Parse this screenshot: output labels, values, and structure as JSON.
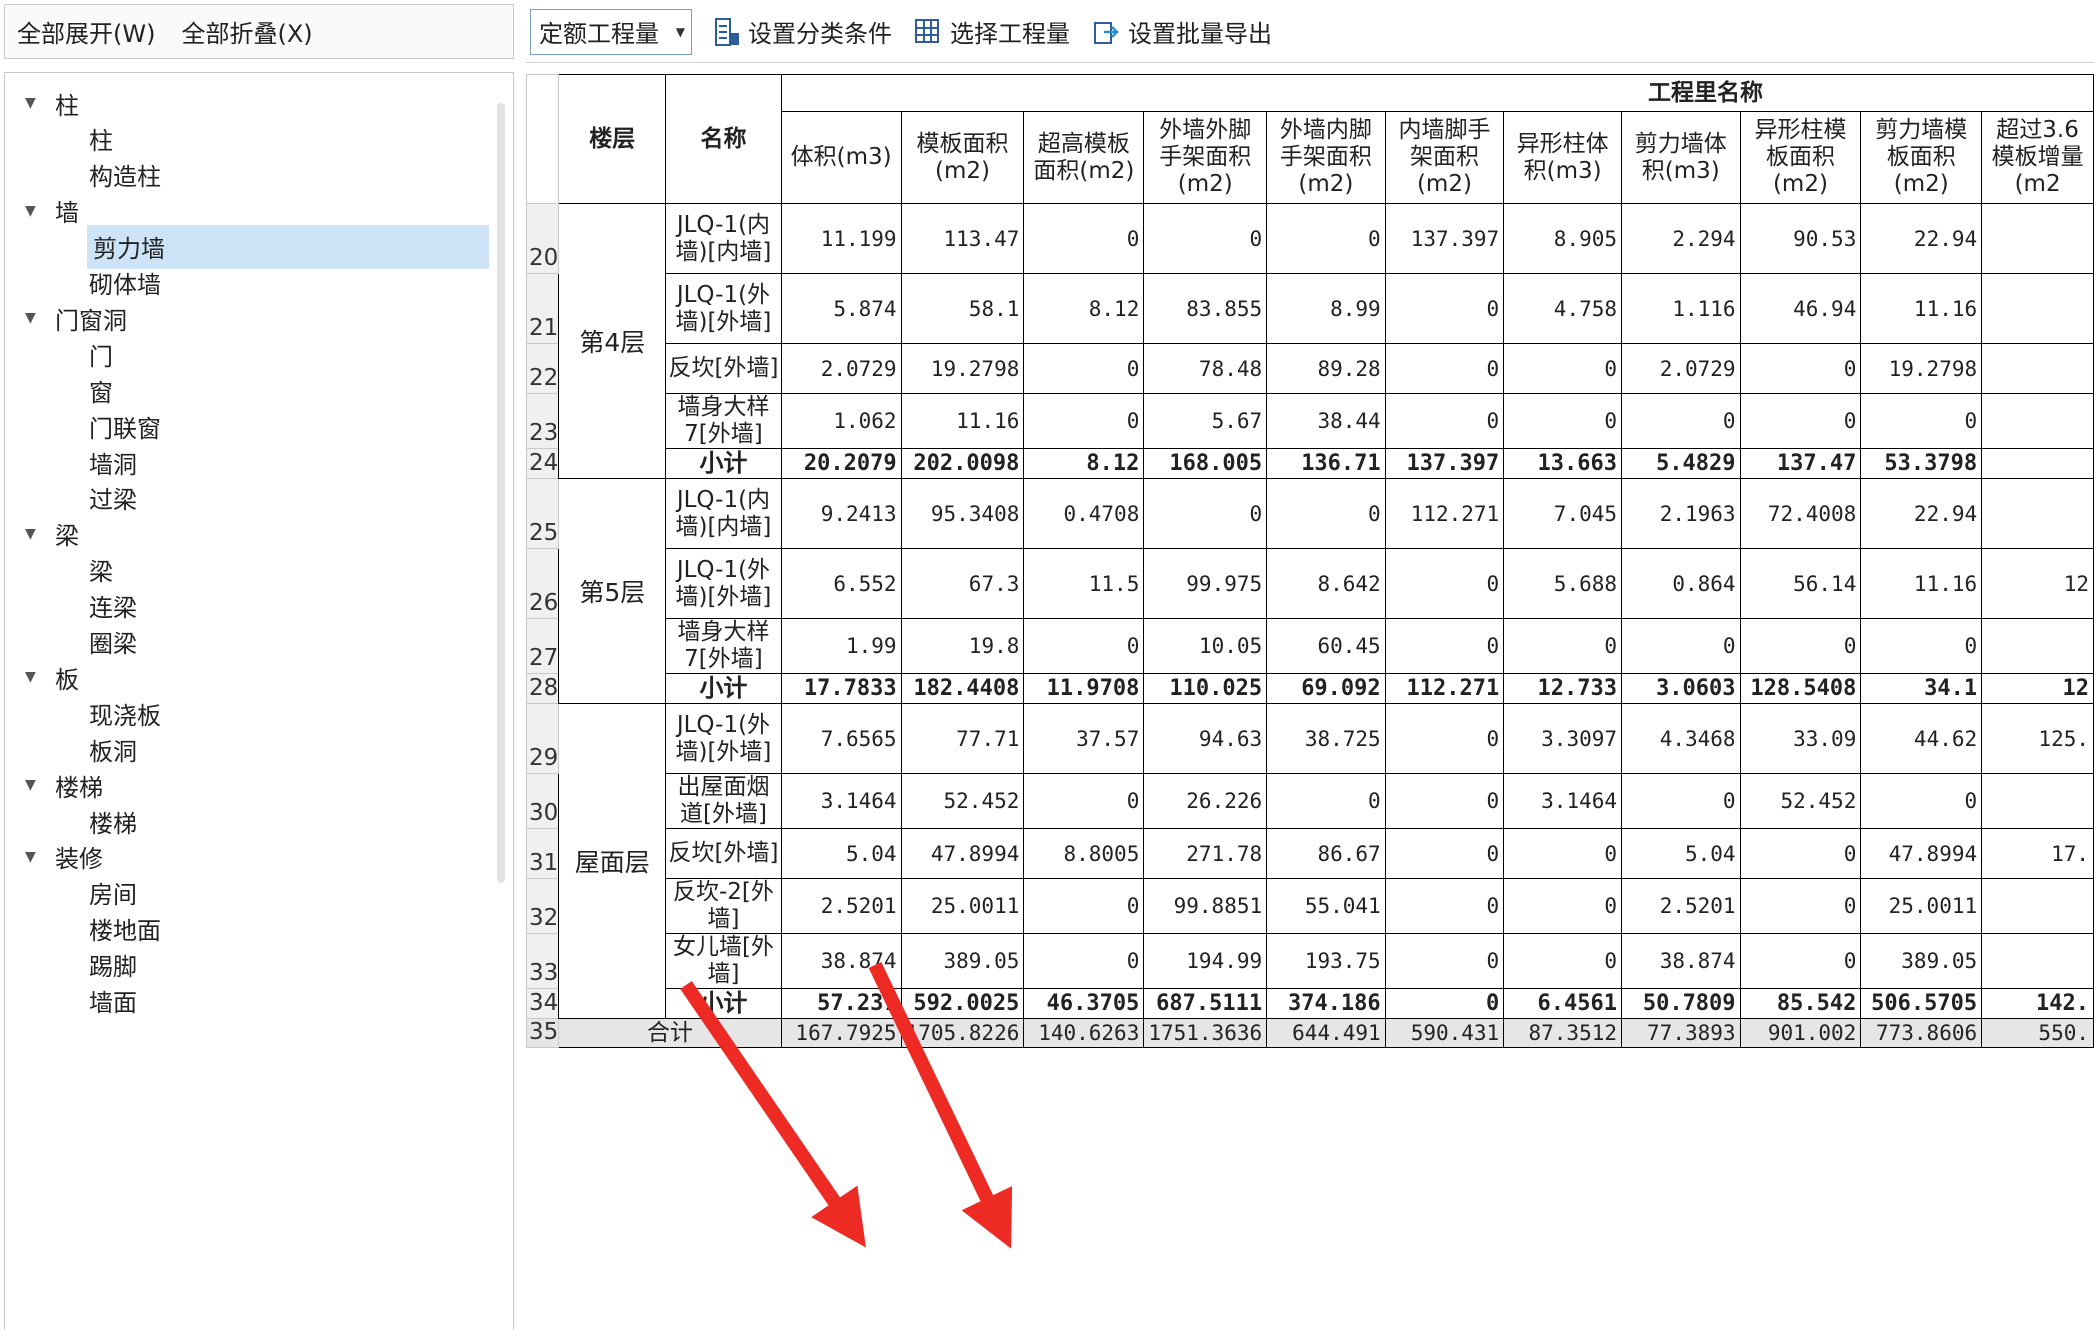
{
  "left_toolbar": {
    "expand_all": "全部展开(W)",
    "collapse_all": "全部折叠(X)"
  },
  "tree": [
    {
      "label": "柱",
      "type": "group"
    },
    {
      "label": "柱",
      "type": "child"
    },
    {
      "label": "构造柱",
      "type": "child"
    },
    {
      "label": "墙",
      "type": "group"
    },
    {
      "label": "剪力墙",
      "type": "child",
      "selected": true
    },
    {
      "label": "砌体墙",
      "type": "child"
    },
    {
      "label": "门窗洞",
      "type": "group"
    },
    {
      "label": "门",
      "type": "child"
    },
    {
      "label": "窗",
      "type": "child"
    },
    {
      "label": "门联窗",
      "type": "child"
    },
    {
      "label": "墙洞",
      "type": "child"
    },
    {
      "label": "过梁",
      "type": "child"
    },
    {
      "label": "梁",
      "type": "group"
    },
    {
      "label": "梁",
      "type": "child"
    },
    {
      "label": "连梁",
      "type": "child"
    },
    {
      "label": "圈梁",
      "type": "child"
    },
    {
      "label": "板",
      "type": "group"
    },
    {
      "label": "现浇板",
      "type": "child"
    },
    {
      "label": "板洞",
      "type": "child"
    },
    {
      "label": "楼梯",
      "type": "group"
    },
    {
      "label": "楼梯",
      "type": "child"
    },
    {
      "label": "装修",
      "type": "group"
    },
    {
      "label": "房间",
      "type": "child"
    },
    {
      "label": "楼地面",
      "type": "child"
    },
    {
      "label": "踢脚",
      "type": "child"
    },
    {
      "label": "墙面",
      "type": "child"
    }
  ],
  "toolbar": {
    "select_value": "定额工程量",
    "set_classify": "设置分类条件",
    "choose_quantity": "选择工程量",
    "batch_export": "设置批量导出"
  },
  "table": {
    "group_header": "工程里名称",
    "floor_header": "楼层",
    "name_header": "名称",
    "columns": [
      "体积(m3)",
      "模板面积(m2)",
      "超高模板面积(m2)",
      "外墙外脚手架面积(m2)",
      "外墙内脚手架面积(m2)",
      "内墙脚手架面积(m2)",
      "异形柱体积(m3)",
      "剪力墙体积(m3)",
      "异形柱模板面积(m2)",
      "剪力墙模板面积(m2)",
      "超过3.6模板增量(m2"
    ],
    "groups": [
      {
        "floor": "第4层",
        "rows": [
          {
            "rn": "20",
            "name": "JLQ-1(内墙)[内墙]",
            "vals": [
              "11.199",
              "113.47",
              "0",
              "0",
              "0",
              "137.397",
              "8.905",
              "2.294",
              "90.53",
              "22.94",
              ""
            ]
          },
          {
            "rn": "21",
            "name": "JLQ-1(外墙)[外墙]",
            "vals": [
              "5.874",
              "58.1",
              "8.12",
              "83.855",
              "8.99",
              "0",
              "4.758",
              "1.116",
              "46.94",
              "11.16",
              ""
            ]
          },
          {
            "rn": "22",
            "name": "反坎[外墙]",
            "vals": [
              "2.0729",
              "19.2798",
              "0",
              "78.48",
              "89.28",
              "0",
              "0",
              "2.0729",
              "0",
              "19.2798",
              ""
            ]
          },
          {
            "rn": "23",
            "name": "墙身大样7[外墙]",
            "vals": [
              "1.062",
              "11.16",
              "0",
              "5.67",
              "38.44",
              "0",
              "0",
              "0",
              "0",
              "0",
              ""
            ]
          }
        ],
        "subtotal": {
          "rn": "24",
          "name": "小计",
          "vals": [
            "20.2079",
            "202.0098",
            "8.12",
            "168.005",
            "136.71",
            "137.397",
            "13.663",
            "5.4829",
            "137.47",
            "53.3798",
            ""
          ]
        }
      },
      {
        "floor": "第5层",
        "rows": [
          {
            "rn": "25",
            "name": "JLQ-1(内墙)[内墙]",
            "vals": [
              "9.2413",
              "95.3408",
              "0.4708",
              "0",
              "0",
              "112.271",
              "7.045",
              "2.1963",
              "72.4008",
              "22.94",
              ""
            ]
          },
          {
            "rn": "26",
            "name": "JLQ-1(外墙)[外墙]",
            "vals": [
              "6.552",
              "67.3",
              "11.5",
              "99.975",
              "8.642",
              "0",
              "5.688",
              "0.864",
              "56.14",
              "11.16",
              "12"
            ]
          },
          {
            "rn": "27",
            "name": "墙身大样7[外墙]",
            "vals": [
              "1.99",
              "19.8",
              "0",
              "10.05",
              "60.45",
              "0",
              "0",
              "0",
              "0",
              "0",
              ""
            ]
          }
        ],
        "subtotal": {
          "rn": "28",
          "name": "小计",
          "vals": [
            "17.7833",
            "182.4408",
            "11.9708",
            "110.025",
            "69.092",
            "112.271",
            "12.733",
            "3.0603",
            "128.5408",
            "34.1",
            "12"
          ]
        }
      },
      {
        "floor": "屋面层",
        "rows": [
          {
            "rn": "29",
            "name": "JLQ-1(外墙)[外墙]",
            "vals": [
              "7.6565",
              "77.71",
              "37.57",
              "94.63",
              "38.725",
              "0",
              "3.3097",
              "4.3468",
              "33.09",
              "44.62",
              "125."
            ]
          },
          {
            "rn": "30",
            "name": "出屋面烟道[外墙]",
            "vals": [
              "3.1464",
              "52.452",
              "0",
              "26.226",
              "0",
              "0",
              "3.1464",
              "0",
              "52.452",
              "0",
              ""
            ]
          },
          {
            "rn": "31",
            "name": "反坎[外墙]",
            "vals": [
              "5.04",
              "47.8994",
              "8.8005",
              "271.78",
              "86.67",
              "0",
              "0",
              "5.04",
              "0",
              "47.8994",
              "17."
            ]
          },
          {
            "rn": "32",
            "name": "反坎-2[外墙]",
            "vals": [
              "2.5201",
              "25.0011",
              "0",
              "99.8851",
              "55.041",
              "0",
              "0",
              "2.5201",
              "0",
              "25.0011",
              ""
            ]
          },
          {
            "rn": "33",
            "name": "女儿墙[外墙]",
            "vals": [
              "38.874",
              "389.05",
              "0",
              "194.99",
              "193.75",
              "0",
              "0",
              "38.874",
              "0",
              "389.05",
              ""
            ]
          }
        ],
        "subtotal": {
          "rn": "34",
          "name": "小计",
          "vals": [
            "57.237",
            "592.0025",
            "46.3705",
            "687.5111",
            "374.186",
            "0",
            "6.4561",
            "50.7809",
            "85.542",
            "506.5705",
            "142."
          ]
        }
      }
    ],
    "total": {
      "rn": "35",
      "name": "合计",
      "vals": [
        "167.7925",
        "1705.8226",
        "140.6263",
        "1751.3636",
        "644.491",
        "590.431",
        "87.3512",
        "77.3893",
        "901.002",
        "773.8606",
        "550."
      ]
    }
  },
  "colors": {
    "arrow": "#ee2a24",
    "selected": "#cde3f8",
    "total_row": "#e6e6e6"
  }
}
